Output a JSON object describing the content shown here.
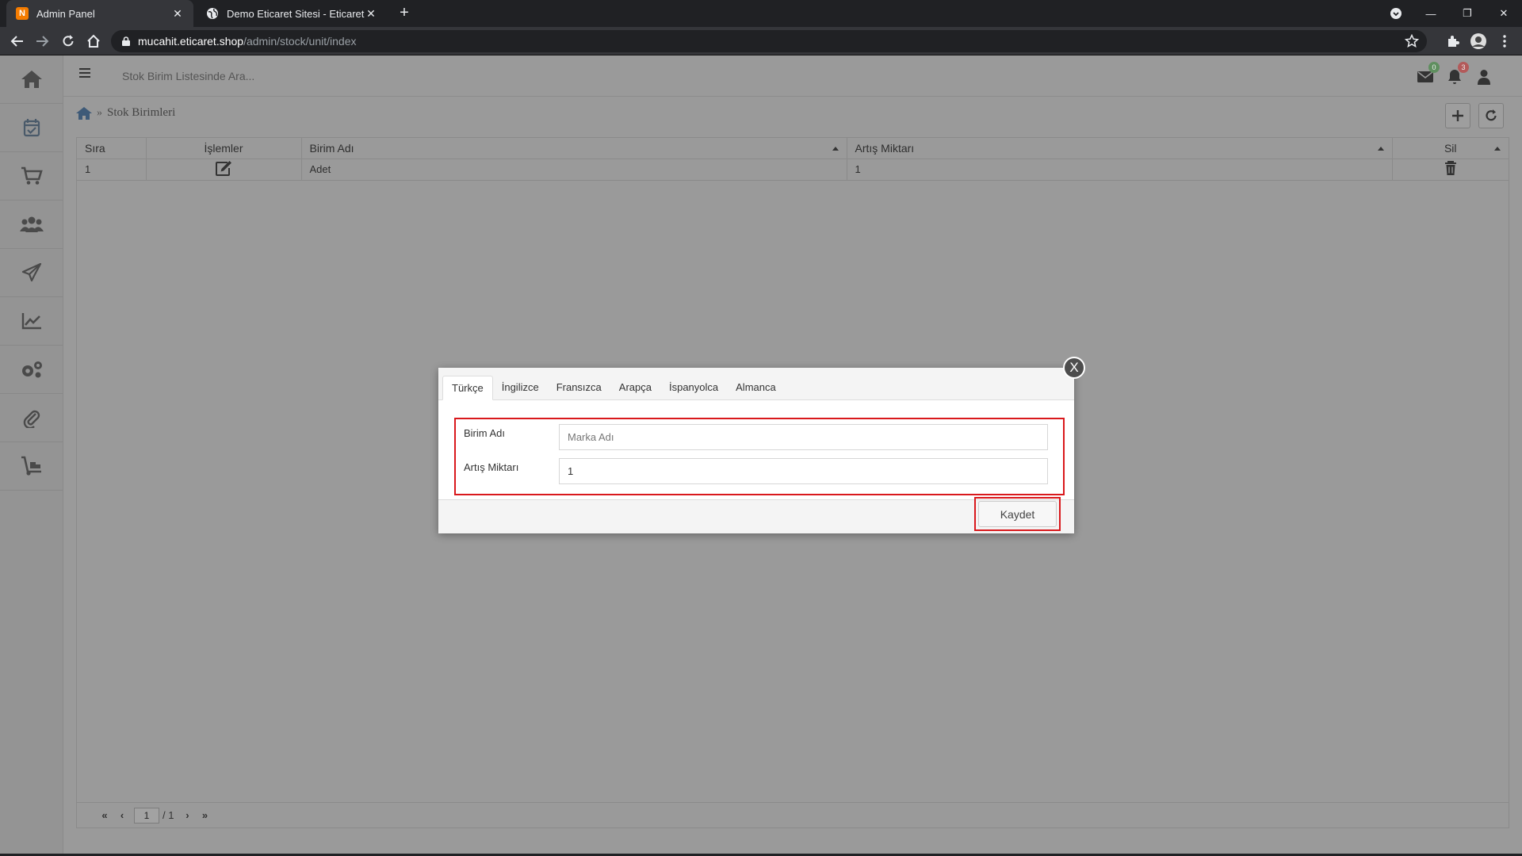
{
  "browser": {
    "tabs": [
      {
        "title": "Admin Panel",
        "favicon": "N",
        "active": true
      },
      {
        "title": "Demo Eticaret Sitesi - Eticaret Sh",
        "active": false
      }
    ],
    "url_host": "mucahit.eticaret.shop",
    "url_path": "/admin/stock/unit/index"
  },
  "sidebar": {
    "items": [
      "home-icon",
      "calendar-check-icon",
      "cart-icon",
      "users-icon",
      "paper-plane-icon",
      "chart-line-icon",
      "gears-icon",
      "paperclip-icon",
      "dolly-icon"
    ]
  },
  "topbar": {
    "search_placeholder": "Stok Birim Listesinde Ara...",
    "mail_badge": "0",
    "notification_badge": "3"
  },
  "breadcrumb": {
    "separator": "»",
    "current": "Stok Birimleri"
  },
  "grid": {
    "columns": [
      "Sıra",
      "İşlemler",
      "Birim Adı",
      "Artış Miktarı",
      "Sil"
    ],
    "rows": [
      {
        "sira": "1",
        "birim_adi": "Adet",
        "artis_miktari": "1"
      }
    ],
    "pager": {
      "page": "1",
      "total": "/ 1"
    }
  },
  "modal": {
    "close_label": "X",
    "tabs": [
      "Türkçe",
      "İngilizce",
      "Fransızca",
      "Arapça",
      "İspanyolca",
      "Almanca"
    ],
    "fields": {
      "birim_label": "Birim Adı",
      "birim_placeholder": "Marka Adı",
      "birim_value": "",
      "artis_label": "Artış Miktarı",
      "artis_value": "1"
    },
    "save_label": "Kaydet"
  },
  "colors": {
    "highlight": "#d9181c",
    "overlay": "#9a9a9a",
    "badge_green": "#5f8f5f",
    "badge_red": "#b35a5a"
  }
}
